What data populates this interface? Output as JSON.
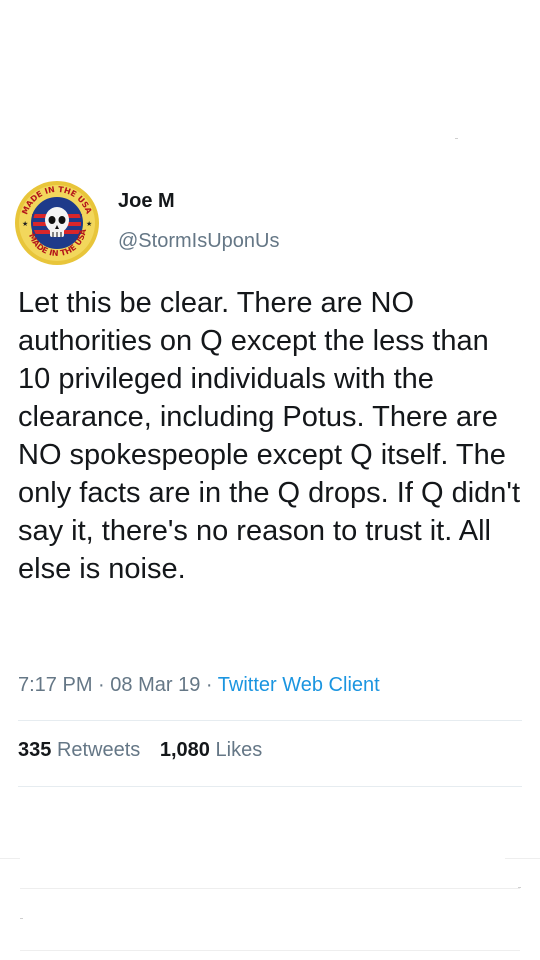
{
  "author": {
    "name": "Joe M",
    "handle": "@StormIsUponUs",
    "avatar_badge_top": "MADE IN THE USA",
    "avatar_badge_bottom": "MADE IN THE USA"
  },
  "tweet": {
    "text": "Let this be clear. There are NO authorities on Q except the less than 10 privileged individuals with the clearance, including Potus. There are NO spokespeople except Q itself. The only facts are in the Q drops. If Q didn't say it, there's no reason to trust it. All else is noise."
  },
  "meta": {
    "time": "7:17 PM",
    "separator": "·",
    "date": "08 Mar 19",
    "client": "Twitter Web Client"
  },
  "stats": {
    "retweets_count": "335",
    "retweets_label": "Retweets",
    "likes_count": "1,080",
    "likes_label": "Likes"
  },
  "colors": {
    "text": "#14171a",
    "secondary": "#657786",
    "link": "#1b95e0",
    "divider": "#e6ecf0"
  }
}
